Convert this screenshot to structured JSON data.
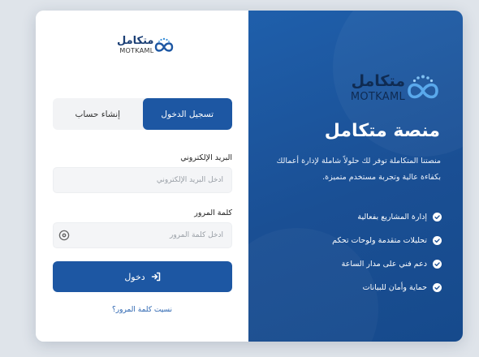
{
  "brand": {
    "name_ar": "متكامل",
    "name_en": "MOTKAML",
    "icon": "infinity-dots-logo"
  },
  "tabs": [
    {
      "label": "تسجيل الدخول",
      "active": true
    },
    {
      "label": "إنشاء حساب",
      "active": false
    }
  ],
  "form": {
    "email_label": "البريد الإلكتروني",
    "email_placeholder": "أدخل البريد الإلكتروني",
    "password_label": "كلمة المرور",
    "password_placeholder": "أدخل كلمة المرور",
    "password_toggle_icon": "eye-icon",
    "submit_label": "دخول",
    "submit_icon": "sign-in-icon",
    "forgot_label": "نسيت كلمة المرور؟"
  },
  "hero": {
    "title": "منصة متكامل",
    "description": "منصتنا المتكاملة توفر لك حلولاً شاملة لإدارة أعمالك بكفاءة عالية وتجربة مستخدم متميزة.",
    "features": [
      "إدارة المشاريع بفعالية",
      "تحليلات متقدمة ولوحات تحكم",
      "دعم فني على مدار الساعة",
      "حماية وأمان للبيانات"
    ]
  },
  "colors": {
    "primary": "#1d57a3",
    "hero_bg": "#1a4f94",
    "background": "#dfe4ea",
    "link": "#2a64b0"
  }
}
